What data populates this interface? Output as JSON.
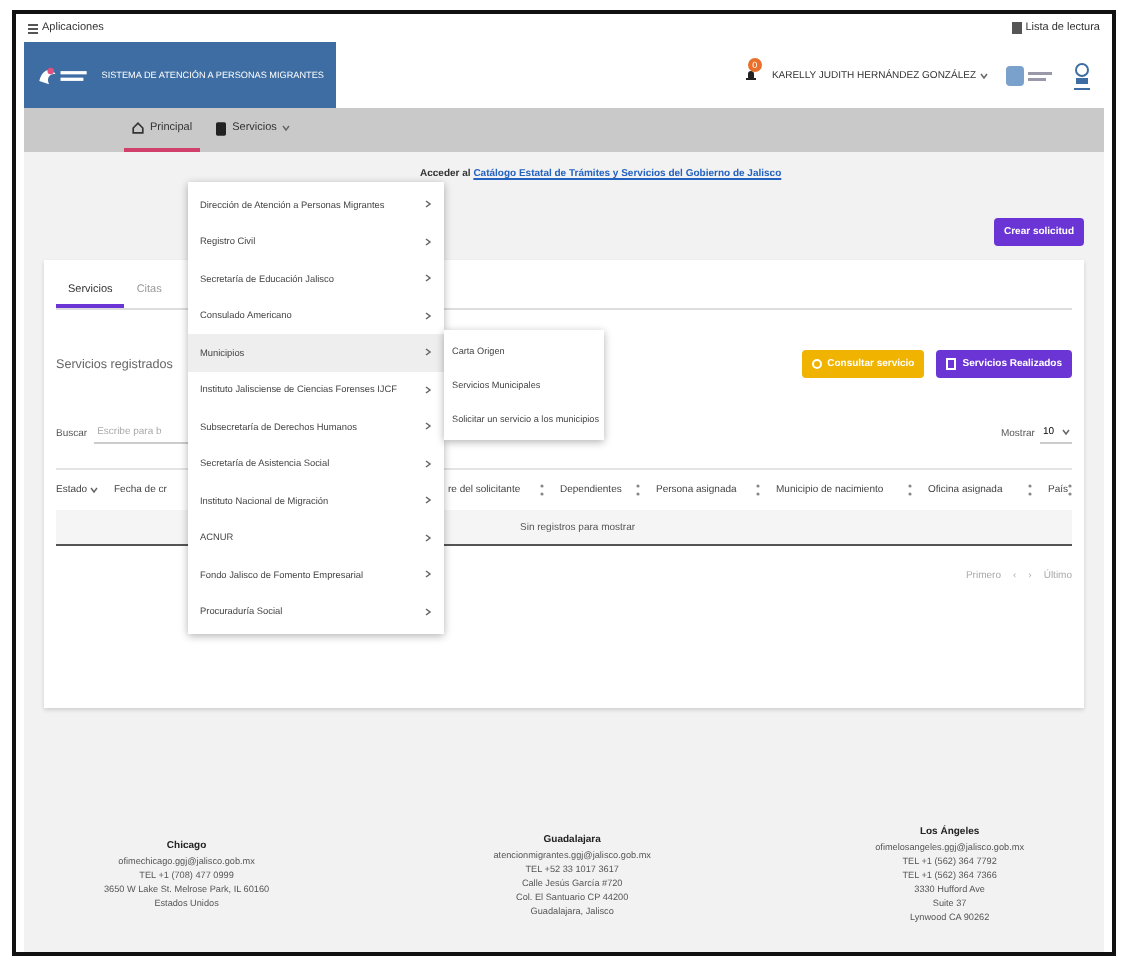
{
  "browser_bar": {
    "apps": "Aplicaciones",
    "reading_list": "Lista de lectura"
  },
  "header": {
    "system_title": "SISTEMA DE ATENCIÓN A PERSONAS MIGRANTES",
    "notification_count": "0",
    "user": "KARELLY JUDITH HERNÁNDEZ GONZÁLEZ"
  },
  "nav": [
    {
      "label": "Principal",
      "selected": true,
      "dropdown": false
    },
    {
      "label": "Servicios",
      "selected": false,
      "dropdown": true
    }
  ],
  "services_menu": [
    {
      "label": "Dirección de Atención a Personas Migrantes",
      "selected": false
    },
    {
      "label": "Registro Civil",
      "selected": false
    },
    {
      "label": "Secretaría de Educación Jalisco",
      "selected": false
    },
    {
      "label": "Consulado Americano",
      "selected": false
    },
    {
      "label": "Municipios",
      "selected": true,
      "children": [
        "Carta Origen",
        "Servicios Municipales",
        "Solicitar un servicio a los municipios"
      ]
    },
    {
      "label": "Instituto Jalisciense de Ciencias Forenses IJCF",
      "selected": false
    },
    {
      "label": "Subsecretaría de Derechos Humanos",
      "selected": false
    },
    {
      "label": "Secretaría de Asistencia Social",
      "selected": false
    },
    {
      "label": "Instituto Nacional de Migración",
      "selected": false
    },
    {
      "label": "ACNUR",
      "selected": false
    },
    {
      "label": "Fondo Jalisco de Fomento Empresarial",
      "selected": false
    },
    {
      "label": "Procuraduría Social",
      "selected": false
    }
  ],
  "catalog_notice": {
    "prefix": "Acceder al",
    "link": "Catálogo Estatal de Trámites y Servicios del Gobierno de Jalisco"
  },
  "create_button": "Crear solicitud",
  "tabs": [
    {
      "label": "Servicios",
      "selected": true
    },
    {
      "label": "Citas",
      "selected": false
    }
  ],
  "section_title": "Servicios registrados",
  "actions": [
    {
      "label": "Consultar servicio",
      "kind": "warning"
    },
    {
      "label": "Servicios Realizados",
      "kind": "primary"
    }
  ],
  "search": {
    "label": "Buscar",
    "placeholder": "Escribe para b"
  },
  "page_size": {
    "label": "Mostrar",
    "value": "10"
  },
  "table": {
    "columns": [
      {
        "label": "Estado"
      },
      {
        "label": "Fecha de cr"
      },
      {
        "label": "re del solicitante"
      },
      {
        "label": "Dependientes"
      },
      {
        "label": "Persona asignada"
      },
      {
        "label": "Municipio de nacimiento"
      },
      {
        "label": "Oficina asignada"
      },
      {
        "label": "País"
      }
    ],
    "empty_message": "Sin registros para mostrar"
  },
  "pagination": [
    "Primero",
    "‹",
    "›",
    "Último"
  ],
  "footer": [
    {
      "city": "Chicago",
      "lines": [
        "ofimechicago.ggj@jalisco.gob.mx",
        "TEL +1 (708) 477 0999",
        "3650 W Lake St. Melrose Park, IL 60160",
        "Estados Unidos"
      ]
    },
    {
      "city": "Guadalajara",
      "lines": [
        "atencionmigrantes.ggj@jalisco.gob.mx",
        "TEL +52 33 1017 3617",
        "Calle Jesús García #720",
        "Col. El Santuario CP 44200",
        "Guadalajara, Jalisco"
      ]
    },
    {
      "city": "Los Ángeles",
      "lines": [
        "ofimelosangeles.ggj@jalisco.gob.mx",
        "TEL +1 (562) 364 7792",
        "TEL +1 (562) 364 7366",
        "3330 Hufford Ave",
        "Suite 37",
        "Lynwood CA 90262"
      ]
    }
  ]
}
